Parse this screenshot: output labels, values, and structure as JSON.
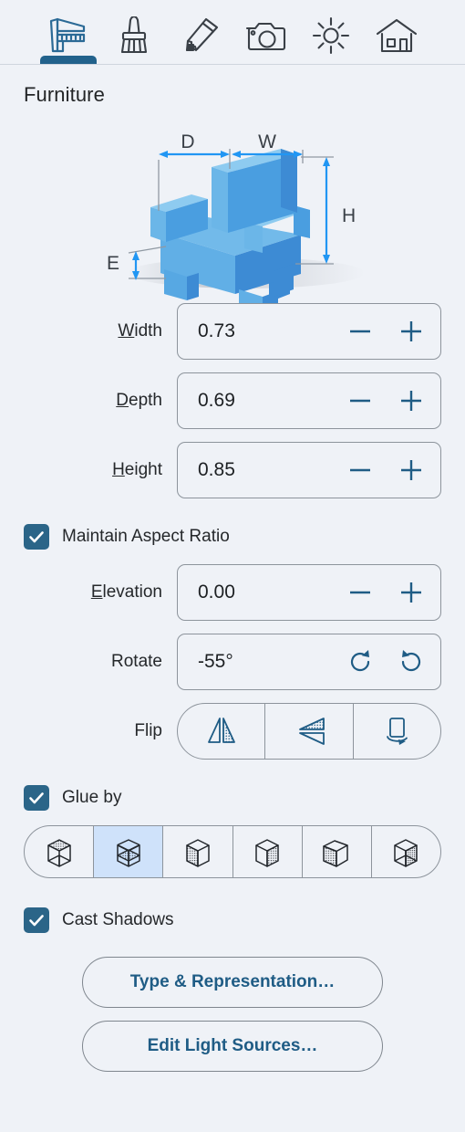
{
  "toolbar": {
    "tools": [
      {
        "name": "caliper-icon",
        "label": "Modify furniture",
        "active": true
      },
      {
        "name": "brush-icon",
        "label": "Paint",
        "active": false
      },
      {
        "name": "pencil-icon",
        "label": "Draw",
        "active": false
      },
      {
        "name": "camera-icon",
        "label": "Photo",
        "active": false
      },
      {
        "name": "sun-icon",
        "label": "Light",
        "active": false
      },
      {
        "name": "house-icon",
        "label": "Home",
        "active": false
      }
    ]
  },
  "header": {
    "title": "Furniture"
  },
  "diagram": {
    "label_depth": "D",
    "label_width": "W",
    "label_height": "H",
    "label_elevation": "E",
    "accent": "#2196f3"
  },
  "fields": {
    "width": {
      "label_pre": "",
      "label_key": "W",
      "label_post": "idth",
      "value": "0.73",
      "minus": "−",
      "plus": "+"
    },
    "depth": {
      "label_pre": "",
      "label_key": "D",
      "label_post": "epth",
      "value": "0.69",
      "minus": "−",
      "plus": "+"
    },
    "height": {
      "label_pre": "",
      "label_key": "H",
      "label_post": "eight",
      "value": "0.85",
      "minus": "−",
      "plus": "+"
    },
    "elevation": {
      "label_pre": "",
      "label_key": "E",
      "label_post": "levation",
      "value": "0.00",
      "minus": "−",
      "plus": "+"
    },
    "rotate": {
      "label": "Rotate",
      "value": "-55°"
    }
  },
  "checkboxes": {
    "maintain_aspect_ratio": {
      "label": "Maintain Aspect Ratio",
      "checked": true
    },
    "glue_by": {
      "label": "Glue by",
      "checked": true
    },
    "cast_shadows": {
      "label": "Cast Shadows",
      "checked": true
    }
  },
  "flip": {
    "label": "Flip",
    "options": [
      {
        "name": "flip-horizontal-icon",
        "label": "Flip horizontally"
      },
      {
        "name": "flip-vertical-icon",
        "label": "Flip vertically"
      },
      {
        "name": "flip-turn-icon",
        "label": "Turn over"
      }
    ]
  },
  "glue_faces": {
    "options": [
      {
        "name": "cube-face-top-icon",
        "label": "Top",
        "selected": false
      },
      {
        "name": "cube-face-bottom-icon",
        "label": "Bottom",
        "selected": true
      },
      {
        "name": "cube-face-left-icon",
        "label": "Left",
        "selected": false
      },
      {
        "name": "cube-face-right-icon",
        "label": "Right",
        "selected": false
      },
      {
        "name": "cube-face-front-icon",
        "label": "Front",
        "selected": false
      },
      {
        "name": "cube-face-back-icon",
        "label": "Back",
        "selected": false
      }
    ]
  },
  "buttons": {
    "type_representation": "Type & Representation…",
    "edit_light_sources": "Edit Light Sources…"
  },
  "colors": {
    "background": "#eff2f7",
    "accent_blue": "#1f5c85",
    "checkbox_fill": "#2b6588",
    "selected_cell": "#cfe2fa",
    "border": "#8d949c",
    "furniture_light": "#6bb6e8",
    "furniture_mid": "#4a9ee0",
    "furniture_dark": "#3d8bd4"
  }
}
